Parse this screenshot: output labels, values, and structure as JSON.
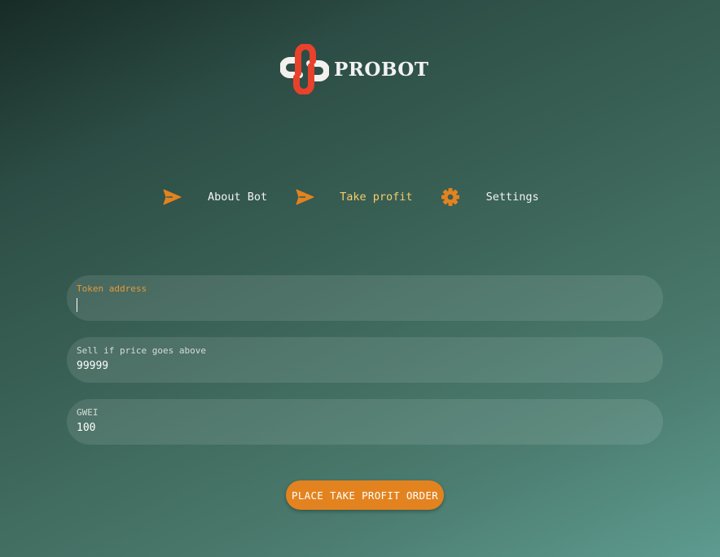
{
  "brand": {
    "name": "PROBOT"
  },
  "nav": {
    "items": [
      {
        "label": "About Bot",
        "icon": "send-icon",
        "active": false
      },
      {
        "label": "Take profit",
        "icon": "send-icon",
        "active": true
      },
      {
        "label": "Settings",
        "icon": "gear-icon",
        "active": false
      }
    ]
  },
  "form": {
    "token": {
      "label": "Token address",
      "value": ""
    },
    "price": {
      "label": "Sell if price goes above",
      "value": "99999"
    },
    "gwei": {
      "label": "GWEI",
      "value": "100"
    },
    "submit_label": "PLACE TAKE PROFIT ORDER"
  },
  "colors": {
    "accent": "#e3831f",
    "active_nav": "#f4cc6c",
    "logo_red": "#e8412c"
  }
}
